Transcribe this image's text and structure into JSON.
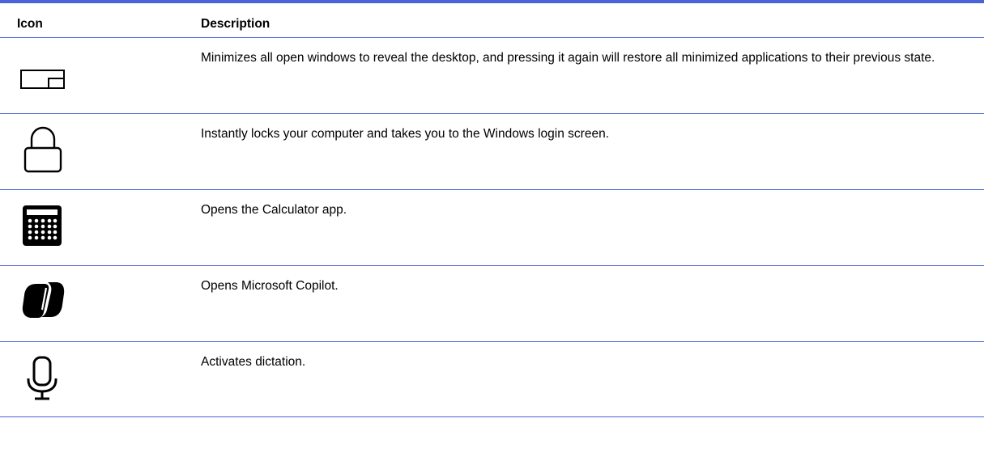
{
  "table": {
    "header": {
      "icon": "Icon",
      "description": "Description"
    },
    "rows": [
      {
        "icon": "show-desktop-icon",
        "description": "Minimizes all open windows to reveal the desktop, and pressing it again will restore all minimized applications to their previous state."
      },
      {
        "icon": "lock-icon",
        "description": "Instantly locks your computer and takes you to the Windows login screen."
      },
      {
        "icon": "calculator-icon",
        "description": "Opens the Calculator app."
      },
      {
        "icon": "copilot-icon",
        "description": "Opens Microsoft Copilot."
      },
      {
        "icon": "microphone-icon",
        "description": "Activates dictation."
      }
    ]
  },
  "colors": {
    "rule": "#4b63d8",
    "text": "#000000"
  }
}
